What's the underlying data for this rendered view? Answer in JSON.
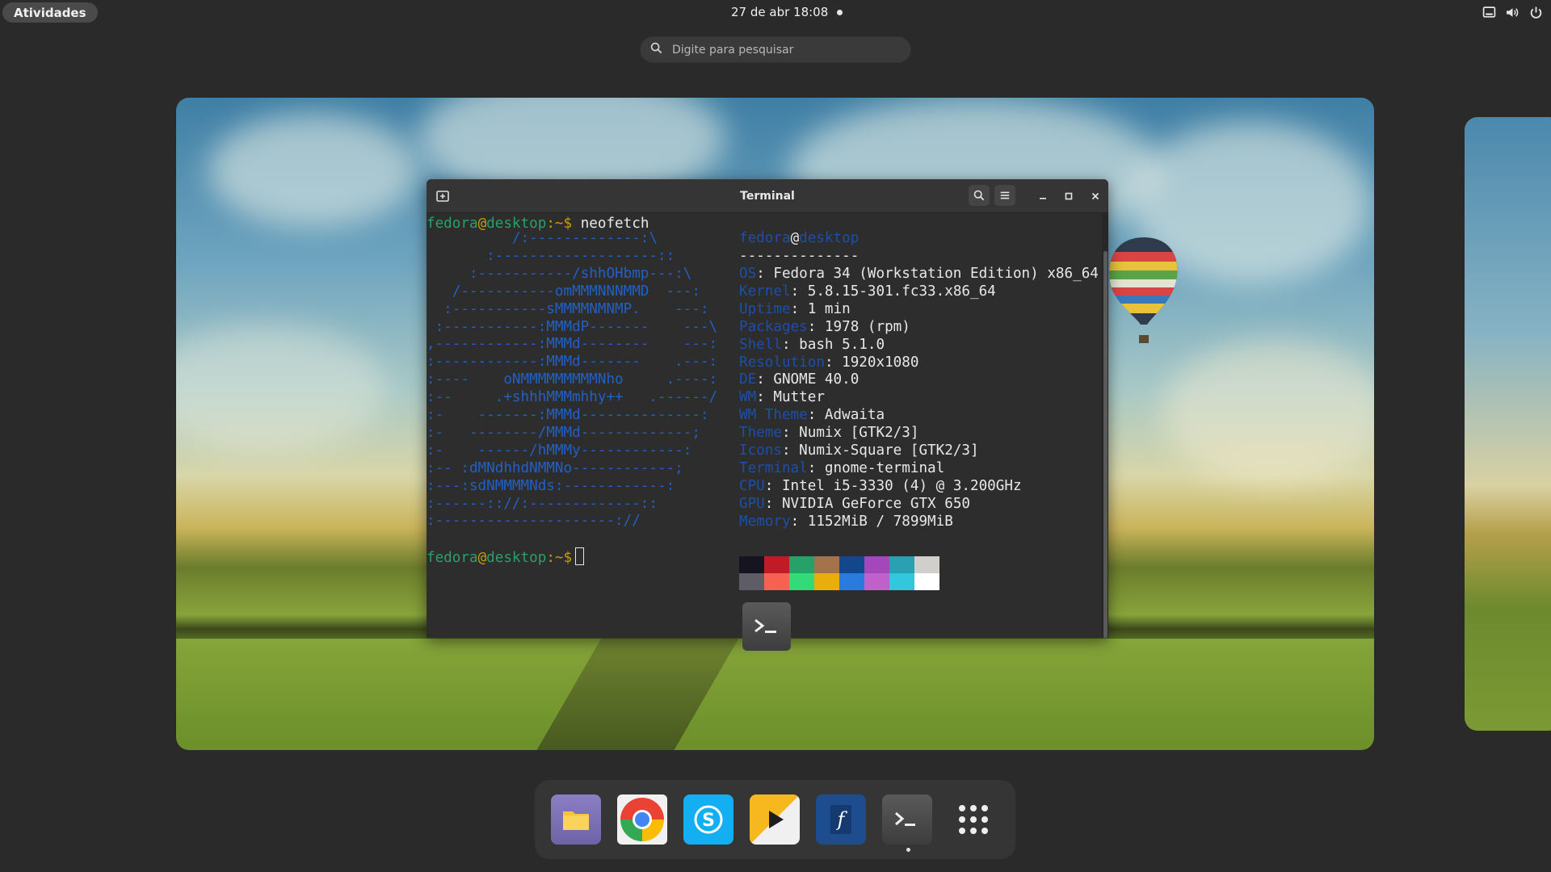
{
  "topbar": {
    "activities_label": "Atividades",
    "clock": "27 de abr  18:08",
    "tray_icons": [
      "screen-icon",
      "volume-icon",
      "power-icon"
    ]
  },
  "search": {
    "placeholder": "Digite para pesquisar"
  },
  "terminal": {
    "title": "Terminal",
    "prompt_user": "fedora",
    "prompt_at": "@",
    "prompt_host": "desktop",
    "prompt_sep": ":~$",
    "command": "neofetch",
    "logo_lines": [
      "          /:-------------:\\",
      "       :-------------------::",
      "     :-----------/shhOHbmp---:\\",
      "   /-----------omMMMNNNMMD  ---:",
      "  :-----------sMMMMNMNMP.    ---:",
      " :-----------:MMMdP-------    ---\\",
      ",------------:MMMd--------    ---:",
      ":------------:MMMd-------    .---:",
      ":----    oNMMMMMMMMMNho     .----:",
      ":--     .+shhhMMMmhhy++   .------/",
      ":-    -------:MMMd--------------:",
      ":-   --------/MMMd-------------;",
      ":-    ------/hMMMy------------:",
      ":-- :dMNdhhdNMMNo------------;",
      ":---:sdNMMMMNds:------------:",
      ":------:://:-------------::",
      ":---------------------://"
    ],
    "info_user": "fedora",
    "info_at": "@",
    "info_host": "desktop",
    "separator": "--------------",
    "info": [
      {
        "label": "OS",
        "value": ": Fedora 34 (Workstation Edition) x86_64"
      },
      {
        "label": "Kernel",
        "value": ": 5.8.15-301.fc33.x86_64"
      },
      {
        "label": "Uptime",
        "value": ": 1 min"
      },
      {
        "label": "Packages",
        "value": ": 1978 (rpm)"
      },
      {
        "label": "Shell",
        "value": ": bash 5.1.0"
      },
      {
        "label": "Resolution",
        "value": ": 1920x1080"
      },
      {
        "label": "DE",
        "value": ": GNOME 40.0"
      },
      {
        "label": "WM",
        "value": ": Mutter"
      },
      {
        "label": "WM Theme",
        "value": ": Adwaita"
      },
      {
        "label": "Theme",
        "value": ": Numix [GTK2/3]"
      },
      {
        "label": "Icons",
        "value": ": Numix-Square [GTK2/3]"
      },
      {
        "label": "Terminal",
        "value": ": gnome-terminal"
      },
      {
        "label": "CPU",
        "value": ": Intel i5-3330 (4) @ 3.200GHz"
      },
      {
        "label": "GPU",
        "value": ": NVIDIA GeForce GTX 650"
      },
      {
        "label": "Memory",
        "value": ": 1152MiB / 7899MiB"
      }
    ],
    "palette_row1": [
      "#171421",
      "#c01c28",
      "#26a269",
      "#a2734c",
      "#12488b",
      "#a347ba",
      "#2aa1b3",
      "#d0cfcc"
    ],
    "palette_row2": [
      "#5e5c64",
      "#f66151",
      "#33da7a",
      "#e9ad0c",
      "#2a7bde",
      "#c061cb",
      "#33c7de",
      "#ffffff"
    ]
  },
  "dock": {
    "apps": [
      "Arquivos",
      "Google Chrome",
      "Skype",
      "Reprodutor de vídeos",
      "Software",
      "Terminal",
      "Mostrar aplicativos"
    ]
  }
}
